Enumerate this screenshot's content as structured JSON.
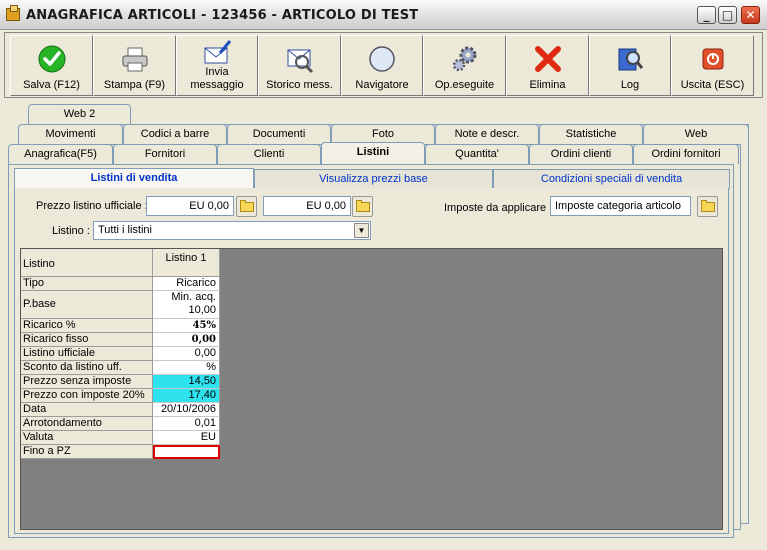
{
  "window": {
    "title": "ANAGRAFICA ARTICOLI - 123456 - ARTICOLO DI TEST",
    "controls": {
      "minimize": "_",
      "maximize": "□",
      "close": "✕"
    }
  },
  "toolbar": [
    {
      "label": "Salva (F12)",
      "icon": "check-icon"
    },
    {
      "label": "Stampa (F9)",
      "icon": "printer-icon"
    },
    {
      "label": "Invia\nmessaggio",
      "icon": "envelope-pen-icon"
    },
    {
      "label": "Storico mess.",
      "icon": "envelope-search-icon"
    },
    {
      "label": "Navigatore",
      "icon": "compass-icon"
    },
    {
      "label": "Op.eseguite",
      "icon": "gears-icon"
    },
    {
      "label": "Elimina",
      "icon": "red-x-icon"
    },
    {
      "label": "Log",
      "icon": "book-search-icon"
    },
    {
      "label": "Uscita (ESC)",
      "icon": "exit-icon"
    }
  ],
  "tabs": {
    "row3": [
      "Web 2"
    ],
    "row2": [
      "Movimenti",
      "Codici a barre",
      "Documenti",
      "Foto",
      "Note e descr.",
      "Statistiche",
      "Web"
    ],
    "row1": [
      "Anagrafica(F5)",
      "Fornitori",
      "Clienti",
      "Listini",
      "Quantita'",
      "Ordini clienti",
      "Ordini fornitori"
    ],
    "active": "Listini"
  },
  "subtabs": [
    "Listini di vendita",
    "Visualizza prezzi base",
    "Condizioni speciali di vendita"
  ],
  "form": {
    "prezzo_listino_label": "Prezzo listino ufficiale :",
    "prezzo_value_1": "EU 0,00",
    "prezzo_value_2": "EU 0,00",
    "imposte_label": "Imposte da applicare :",
    "imposte_value": "Imposte categoria articolo",
    "listino_label": "Listino :",
    "listino_value": "Tutti i listini"
  },
  "grid": {
    "header_label": "Listino",
    "column": "Listino 1",
    "rows": [
      {
        "label": "Tipo",
        "value": "Ricarico"
      },
      {
        "label": "P.base",
        "value": "Min. acq.",
        "value2": "10,00"
      },
      {
        "label": "Ricarico %",
        "value": "45%"
      },
      {
        "label": "Ricarico fisso",
        "value": "0,00"
      },
      {
        "label": "Listino ufficiale",
        "value": "0,00"
      },
      {
        "label": "Sconto da listino uff.",
        "value": "%"
      },
      {
        "label": "Prezzo senza imposte",
        "value": "14,50"
      },
      {
        "label": "Prezzo con imposte 20%",
        "value": "17,40"
      },
      {
        "label": "Data",
        "value": "20/10/2006"
      },
      {
        "label": "Arrotondamento",
        "value": "0,01"
      },
      {
        "label": "Valuta",
        "value": "EU"
      },
      {
        "label": "Fino a PZ",
        "value": ""
      }
    ]
  },
  "colors": {
    "highlight_cyan": "#2ee3ee",
    "grid_background": "#808080",
    "subtab_text": "#0033cc",
    "selection_border": "#e00000"
  }
}
